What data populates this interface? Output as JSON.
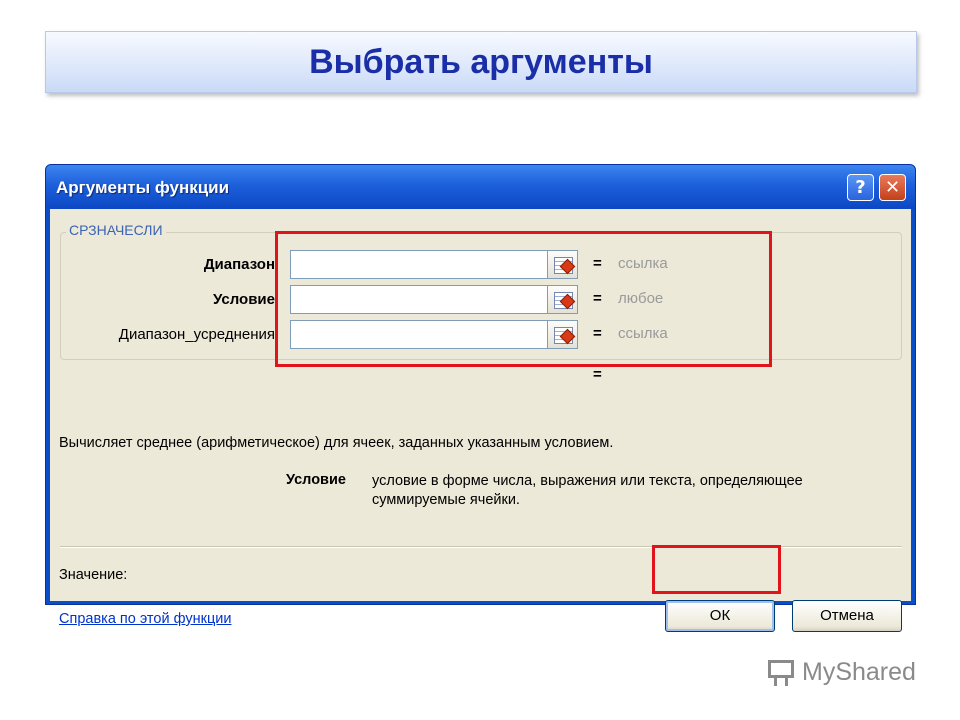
{
  "slide": {
    "title": "Выбрать аргументы",
    "brand": "MyShared"
  },
  "dialog": {
    "title": "Аргументы функции",
    "help_button": "?",
    "close_button": "✕",
    "function_name": "СРЗНАЧЕСЛИ",
    "arguments": [
      {
        "label": "Диапазон",
        "bold": true,
        "value": "",
        "hint": "ссылка"
      },
      {
        "label": "Условие",
        "bold": true,
        "value": "",
        "hint": "любое"
      },
      {
        "label": "Диапазон_усреднения",
        "bold": false,
        "value": "",
        "hint": "ссылка"
      }
    ],
    "equals": "=",
    "result_equals": "=",
    "description": "Вычисляет среднее (арифметическое) для ячеек, заданных указанным условием.",
    "param_name": "Условие",
    "param_description": "условие в форме числа, выражения или текста, определяющее суммируемые ячейки.",
    "value_label": "Значение:",
    "help_link": "Справка по этой функции",
    "ok_button": "ОК",
    "cancel_button": "Отмена"
  },
  "colors": {
    "highlight": "#e0141a",
    "title_text": "#1a2ea8",
    "titlebar": "#1d5fdc",
    "dialog_bg": "#ece9d8",
    "link": "#0033cc",
    "hint": "#9a9a9a"
  }
}
